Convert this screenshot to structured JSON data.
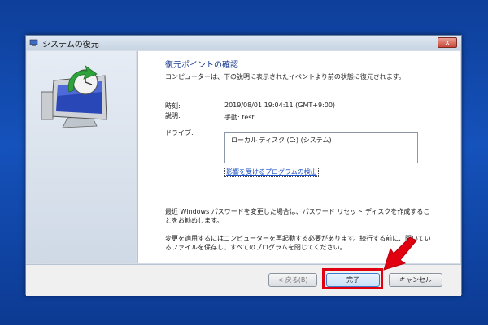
{
  "window": {
    "title": "システムの復元",
    "close_label": "x"
  },
  "content": {
    "heading": "復元ポイントの確認",
    "description": "コンピューターは、下の説明に表示されたイベントより前の状態に復元されます。",
    "time_label": "時刻:",
    "time_value": "2019/08/01 19:04:11 (GMT+9:00)",
    "desc_label": "説明:",
    "desc_value": "手動: test",
    "drives_label": "ドライブ:",
    "drive_item": "ローカル ディスク (C:) (システム)",
    "affected_link": "影響を受けるプログラムの検出",
    "password_note": "最近 Windows パスワードを変更した場合は、パスワード リセット ディスクを作成することをお勧めします。",
    "restart_note": "変更を適用するにはコンピューターを再起動する必要があります。続行する前に、開いているファイルを保存し、すべてのプログラムを閉じてください。"
  },
  "footer": {
    "back_label": "< 戻る(B)",
    "finish_label": "完了",
    "cancel_label": "キャンセル"
  },
  "colors": {
    "highlight": "#e10010",
    "desktop": "#1552bb",
    "heading": "#1b3d8f"
  }
}
